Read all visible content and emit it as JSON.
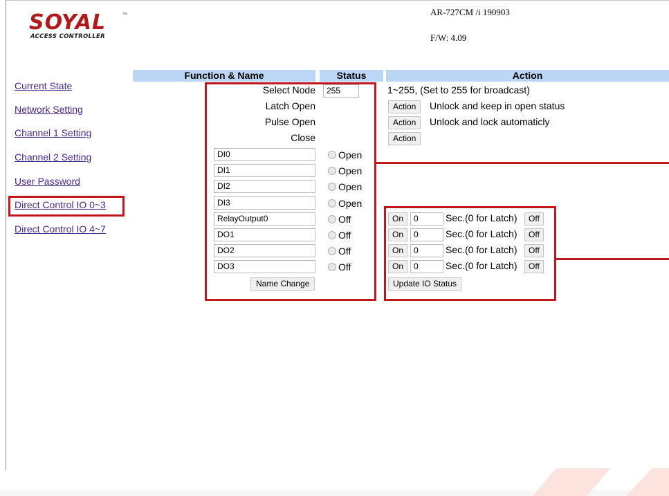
{
  "brand": {
    "name": "SOYAL",
    "tm": "™",
    "tagline": "ACCESS CONTROLLER"
  },
  "device": {
    "model": "AR-727CM /i 190903",
    "firmware": "F/W: 4.09"
  },
  "sidebar": {
    "items": [
      {
        "label": "Current State"
      },
      {
        "label": "Network Setting"
      },
      {
        "label": "Channel 1 Setting"
      },
      {
        "label": "Channel 2 Setting"
      },
      {
        "label": "User Password"
      },
      {
        "label": "Direct Control IO 0~3"
      },
      {
        "label": "Direct Control IO 4~7"
      }
    ]
  },
  "table": {
    "headers": {
      "function": "Function & Name",
      "status": "Status",
      "action": "Action"
    },
    "select_node": {
      "label": "Select Node",
      "value": "255",
      "hint": "1~255, (Set to 255 for broadcast)"
    },
    "latch_open": {
      "label": "Latch Open",
      "button": "Action",
      "desc": "Unlock and keep in open status"
    },
    "pulse_open": {
      "label": "Pulse Open",
      "button": "Action",
      "desc": "Unlock and lock automaticly"
    },
    "close": {
      "label": "Close",
      "button": "Action"
    },
    "inputs": [
      {
        "name": "DI0",
        "status": "Open"
      },
      {
        "name": "DI1",
        "status": "Open"
      },
      {
        "name": "DI2",
        "status": "Open"
      },
      {
        "name": "DI3",
        "status": "Open"
      }
    ],
    "outputs": [
      {
        "name": "RelayOutput0",
        "status": "Off",
        "on": "On",
        "seconds": "0",
        "sec_label": "Sec.(0 for Latch)",
        "off": "Off"
      },
      {
        "name": "DO1",
        "status": "Off",
        "on": "On",
        "seconds": "0",
        "sec_label": "Sec.(0 for Latch)",
        "off": "Off"
      },
      {
        "name": "DO2",
        "status": "Off",
        "on": "On",
        "seconds": "0",
        "sec_label": "Sec.(0 for Latch)",
        "off": "Off"
      },
      {
        "name": "DO3",
        "status": "Off",
        "on": "On",
        "seconds": "0",
        "sec_label": "Sec.(0 for Latch)",
        "off": "Off"
      }
    ],
    "name_change": "Name Change",
    "update_io": "Update IO Status"
  },
  "colors": {
    "brand_red": "#b01a1a",
    "header_blue": "#bcd7f5",
    "highlight_red": "#c0161e",
    "link": "#4a2a8a"
  }
}
